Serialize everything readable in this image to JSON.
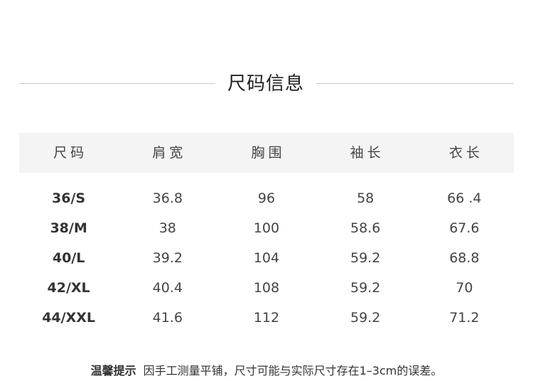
{
  "title": "尺码信息",
  "table": {
    "headers": [
      "尺码",
      "肩宽",
      "胸围",
      "袖长",
      "衣长"
    ],
    "rows": [
      [
        "36/S",
        "36.8",
        "96",
        "58",
        "66 .4"
      ],
      [
        "38/M",
        "38",
        "100",
        "58.6",
        "67.6"
      ],
      [
        "40/L",
        "39.2",
        "104",
        "59.2",
        "68.8"
      ],
      [
        "42/XL",
        "40.4",
        "108",
        "59.2",
        "70"
      ],
      [
        "44/XXL",
        "41.6",
        "112",
        "59.2",
        "71.2"
      ]
    ]
  },
  "note": {
    "label": "温馨提示",
    "text": "因手工测量平铺，尺寸可能与实际尺寸存在1–3cm的误差。"
  }
}
